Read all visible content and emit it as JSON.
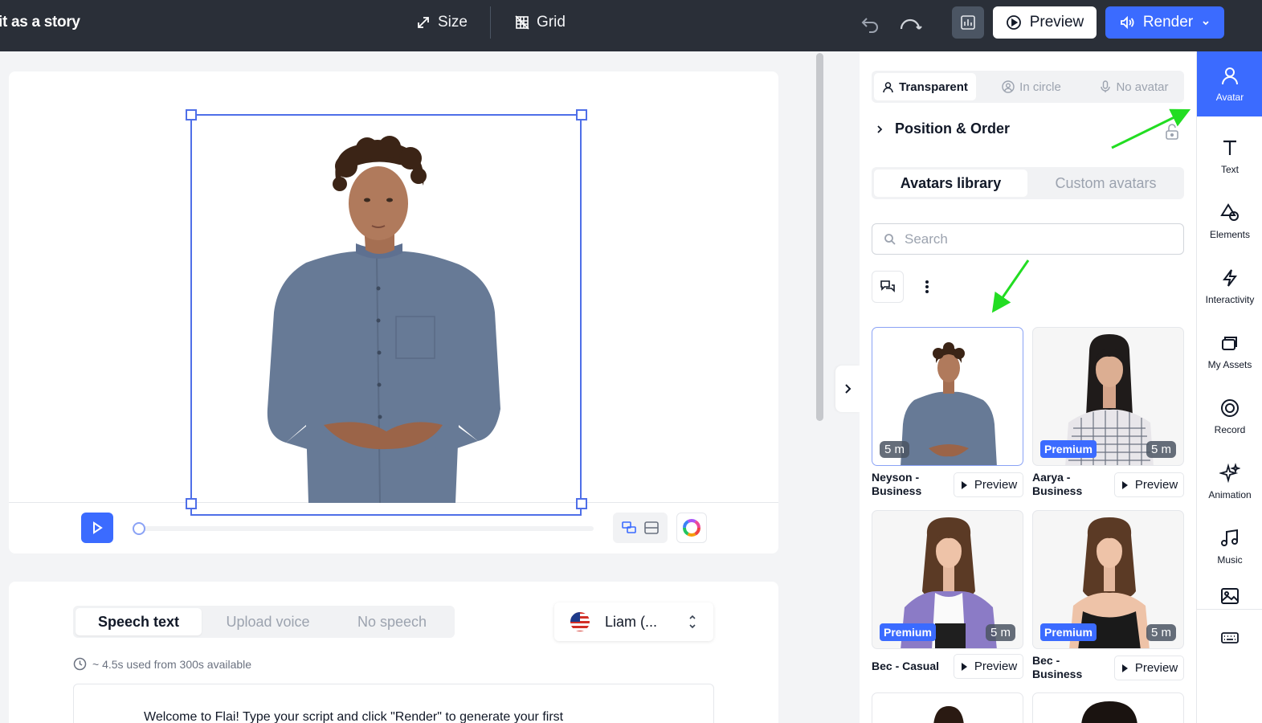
{
  "header": {
    "title": "it as a story",
    "size_label": "Size",
    "grid_label": "Grid",
    "preview_label": "Preview",
    "render_label": "Render"
  },
  "speech": {
    "tabs": [
      "Speech text",
      "Upload voice",
      "No speech"
    ],
    "active_tab": "Speech text",
    "voice": "Liam (...",
    "usage": "~ 4.5s used from 300s available",
    "script": "Welcome to Flai! Type your script and click \"Render\" to generate your first"
  },
  "panel": {
    "mode_tabs": [
      "Transparent",
      "In circle",
      "No avatar"
    ],
    "active_mode": "Transparent",
    "section_title": "Position & Order",
    "library_tabs": [
      "Avatars library",
      "Custom avatars"
    ],
    "active_library": "Avatars library",
    "search_placeholder": "Search",
    "preview_label": "Preview",
    "avatars": [
      {
        "name": "Neyson - Business",
        "duration": "5 m",
        "premium": false
      },
      {
        "name": "Aarya - Business",
        "duration": "5 m",
        "premium": true,
        "badge": "Premium"
      },
      {
        "name": "Bec - Casual",
        "duration": "5 m",
        "premium": true,
        "badge": "Premium"
      },
      {
        "name": "Bec - Business",
        "duration": "5 m",
        "premium": true,
        "badge": "Premium"
      }
    ]
  },
  "rail": {
    "items": [
      "Avatar",
      "Text",
      "Elements",
      "Interactivity",
      "My Assets",
      "Record",
      "Animation",
      "Music"
    ],
    "active": "Avatar"
  },
  "colors": {
    "accent": "#3b6bff",
    "topbar": "#2a2f38",
    "annotation_arrow": "#22dd22"
  }
}
